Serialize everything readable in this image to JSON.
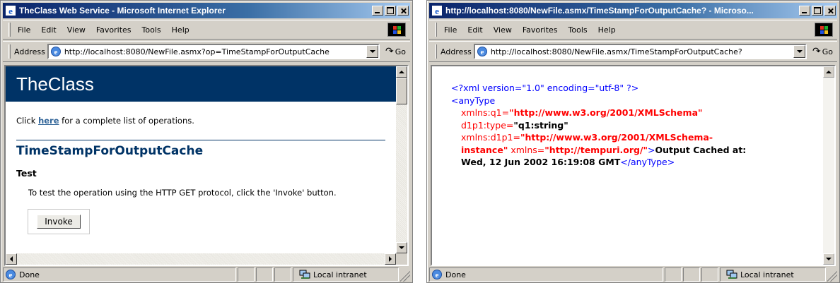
{
  "window1": {
    "title": "TheClass Web Service - Microsoft Internet Explorer",
    "menu": [
      "File",
      "Edit",
      "View",
      "Favorites",
      "Tools",
      "Help"
    ],
    "address_label": "Address",
    "address_url": "http://localhost:8080/NewFile.asmx?op=TimeStampForOutputCache",
    "go_label": "Go",
    "page": {
      "header": "TheClass",
      "click_prefix": "Click ",
      "click_link": "here",
      "click_suffix": " for a complete list of operations.",
      "operation_title": "TimeStampForOutputCache",
      "test_heading": "Test",
      "test_description": "To test the operation using the HTTP GET protocol, click the 'Invoke' button.",
      "invoke_button": "Invoke"
    },
    "status": "Done",
    "zone": "Local intranet"
  },
  "window2": {
    "title": "http://localhost:8080/NewFile.asmx/TimeStampForOutputCache? - Microso...",
    "menu": [
      "File",
      "Edit",
      "View",
      "Favorites",
      "Tools",
      "Help"
    ],
    "address_label": "Address",
    "address_url": "http://localhost:8080/NewFile.asmx/TimeStampForOutputCache?",
    "go_label": "Go",
    "xml": {
      "decl": "<?xml version=\"1.0\" encoding=\"utf-8\" ?>",
      "open_tag": "<anyType",
      "attr1_name": "xmlns:q1=",
      "attr1_value": "\"http://www.w3.org/2001/XMLSchema\"",
      "attr2_name": "d1p1:type=",
      "attr2_value": "\"q1:string\"",
      "attr3_name": "xmlns:d1p1=",
      "attr3_value_a": "\"http://www.w3.org/2001/XMLSchema-",
      "attr3_value_b": "instance\"",
      "attr4_name": " xmlns=",
      "attr4_value": "\"http://tempuri.org/\"",
      "tag_close_bracket": ">",
      "text_a": "Output Cached at:",
      "text_b": "Wed, 12 Jun 2002 16:19:08 GMT",
      "close_tag": "</anyType>"
    },
    "status": "Done",
    "zone": "Local intranet"
  }
}
